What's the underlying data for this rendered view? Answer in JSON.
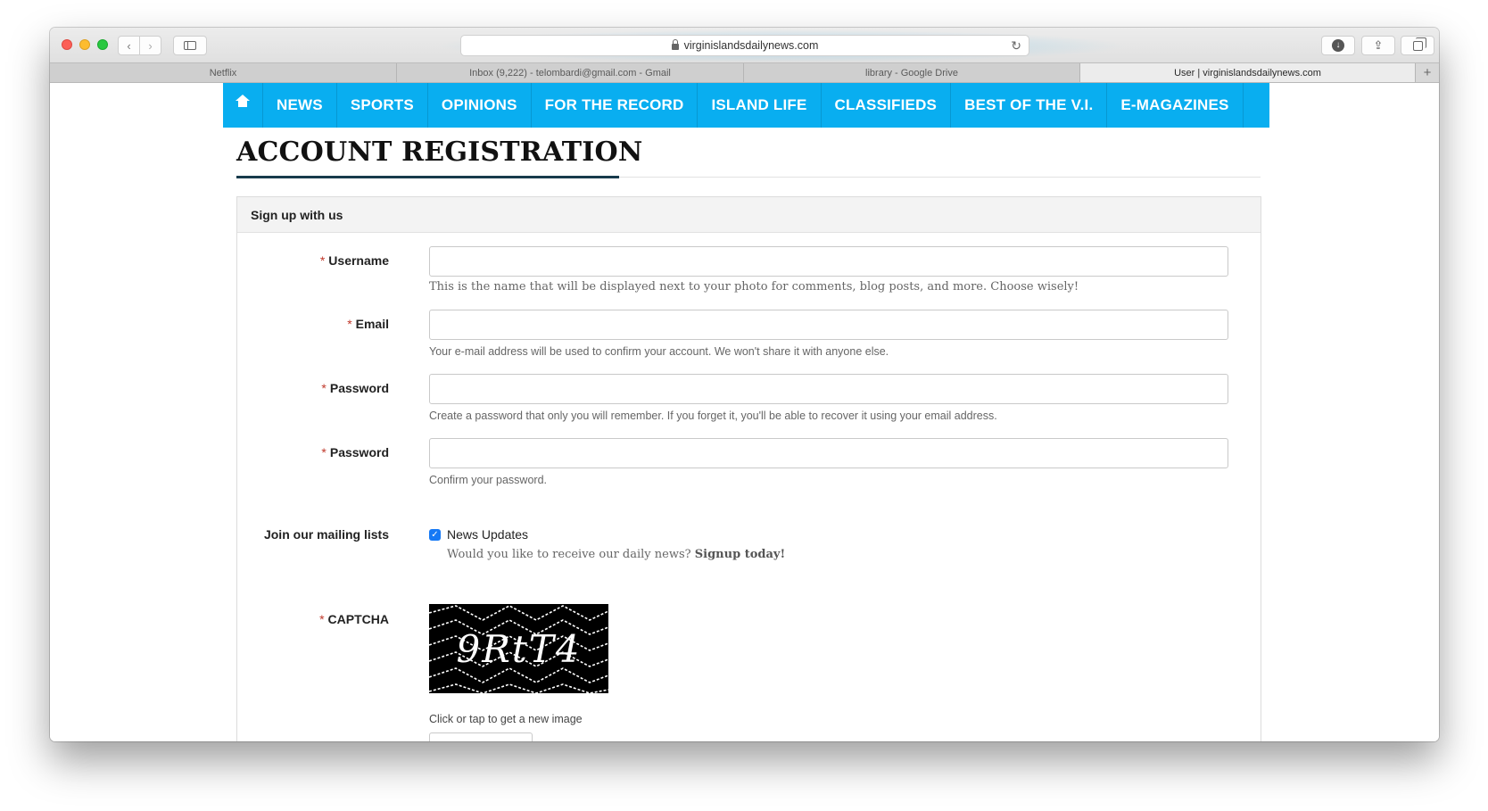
{
  "browser": {
    "url": "virginislandsdailynews.com",
    "tabs": [
      {
        "title": "Netflix",
        "active": false
      },
      {
        "title": "Inbox (9,222) - telombardi@gmail.com - Gmail",
        "active": false
      },
      {
        "title": "library - Google Drive",
        "active": false
      },
      {
        "title": "User | virginislandsdailynews.com",
        "active": true
      }
    ],
    "new_tab_label": "+"
  },
  "nav": {
    "home_icon": "home-icon",
    "items": [
      "NEWS",
      "SPORTS",
      "OPINIONS",
      "FOR THE RECORD",
      "ISLAND LIFE",
      "CLASSIFIEDS",
      "BEST OF THE V.I.",
      "E-MAGAZINES"
    ],
    "background": "#09aef0"
  },
  "page": {
    "title": "ACCOUNT REGISTRATION",
    "panel_heading": "Sign up with us"
  },
  "form": {
    "required_marker": "*",
    "username": {
      "label": "Username",
      "value": "",
      "hint": "This is the name that will be displayed next to your photo for comments, blog posts, and more. Choose wisely!"
    },
    "email": {
      "label": "Email",
      "value": "",
      "hint": "Your e-mail address will be used to confirm your account. We won't share it with anyone else."
    },
    "password": {
      "label": "Password",
      "value": "",
      "hint": "Create a password that only you will remember. If you forget it, you'll be able to recover it using your email address."
    },
    "password_confirm": {
      "label": "Password",
      "value": "",
      "hint": "Confirm your password."
    },
    "mailing": {
      "label": "Join our mailing lists",
      "option_label": "News Updates",
      "checked": true,
      "note": "Would you like to receive our daily news?",
      "note_link": "Signup today!"
    },
    "captcha": {
      "label": "CAPTCHA",
      "image_text": "9RtT4",
      "hint": "Click or tap to get a new image",
      "value": ""
    }
  }
}
